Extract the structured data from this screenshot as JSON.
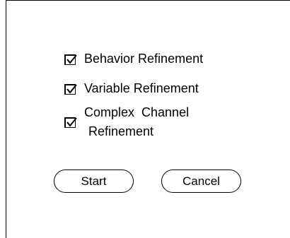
{
  "options": [
    {
      "label": "Behavior Refinement",
      "checked": true
    },
    {
      "label": "Variable Refinement",
      "checked": true
    },
    {
      "label_line1": "Complex  Channel",
      "label_line2": "Refinement",
      "checked": true
    }
  ],
  "buttons": {
    "start_label": "Start",
    "cancel_label": "Cancel"
  }
}
